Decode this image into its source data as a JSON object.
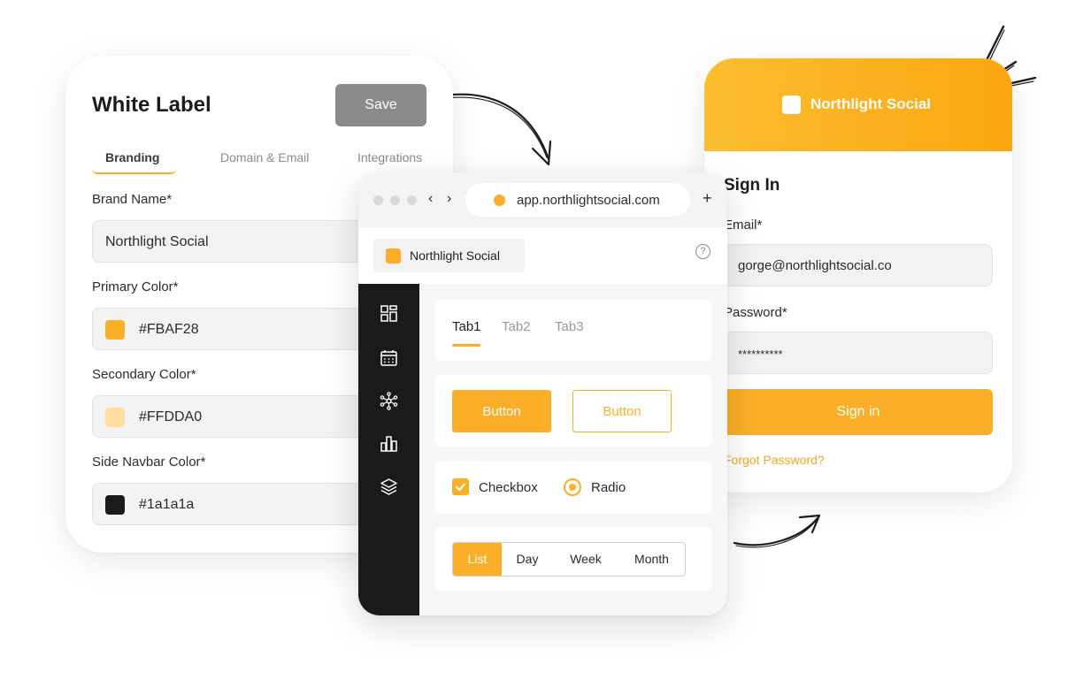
{
  "white_label": {
    "title": "White Label",
    "save_label": "Save",
    "tabs": [
      "Branding",
      "Domain & Email",
      "Integrations"
    ],
    "active_tab": "Branding",
    "fields": [
      {
        "label": "Brand Name*",
        "value": "Northlight Social"
      },
      {
        "label": "Primary Color*",
        "value": "#FBAF28",
        "swatch": "#fbaf28"
      },
      {
        "label": "Secondary Color*",
        "value": "#FFDDA0",
        "swatch": "#ffdda0"
      },
      {
        "label": "Side Navbar Color*",
        "value": "#1a1a1a",
        "swatch": "#1a1a1a"
      }
    ]
  },
  "browser": {
    "url": "app.northlightsocial.com",
    "back_icon": "‹",
    "forward_icon": "›",
    "new_tab_icon": "+",
    "brand": "Northlight Social",
    "help_icon": "?",
    "sidebar_icons": [
      "dashboard-icon",
      "calendar-icon",
      "network-icon",
      "analytics-icon",
      "layers-icon"
    ],
    "tabs": [
      "Tab1",
      "Tab2",
      "Tab3"
    ],
    "active_tab": "Tab1",
    "buttons": {
      "primary": "Button",
      "outline": "Button"
    },
    "checkbox_label": "Checkbox",
    "radio_label": "Radio",
    "segmented": [
      "List",
      "Day",
      "Week",
      "Month"
    ],
    "active_segment": "List"
  },
  "sign_in": {
    "brand": "Northlight Social",
    "title": "Sign In",
    "email_label": "Email*",
    "email_value": "gorge@northlightsocial.co",
    "password_label": "Password*",
    "password_value": "**********",
    "submit_label": "Sign in",
    "forgot_label": "Forgot Password?"
  },
  "colors": {
    "accent": "#fbaf28",
    "secondary": "#ffdda0",
    "navbar": "#1a1a1a",
    "save_button": "#8b8b8b"
  }
}
